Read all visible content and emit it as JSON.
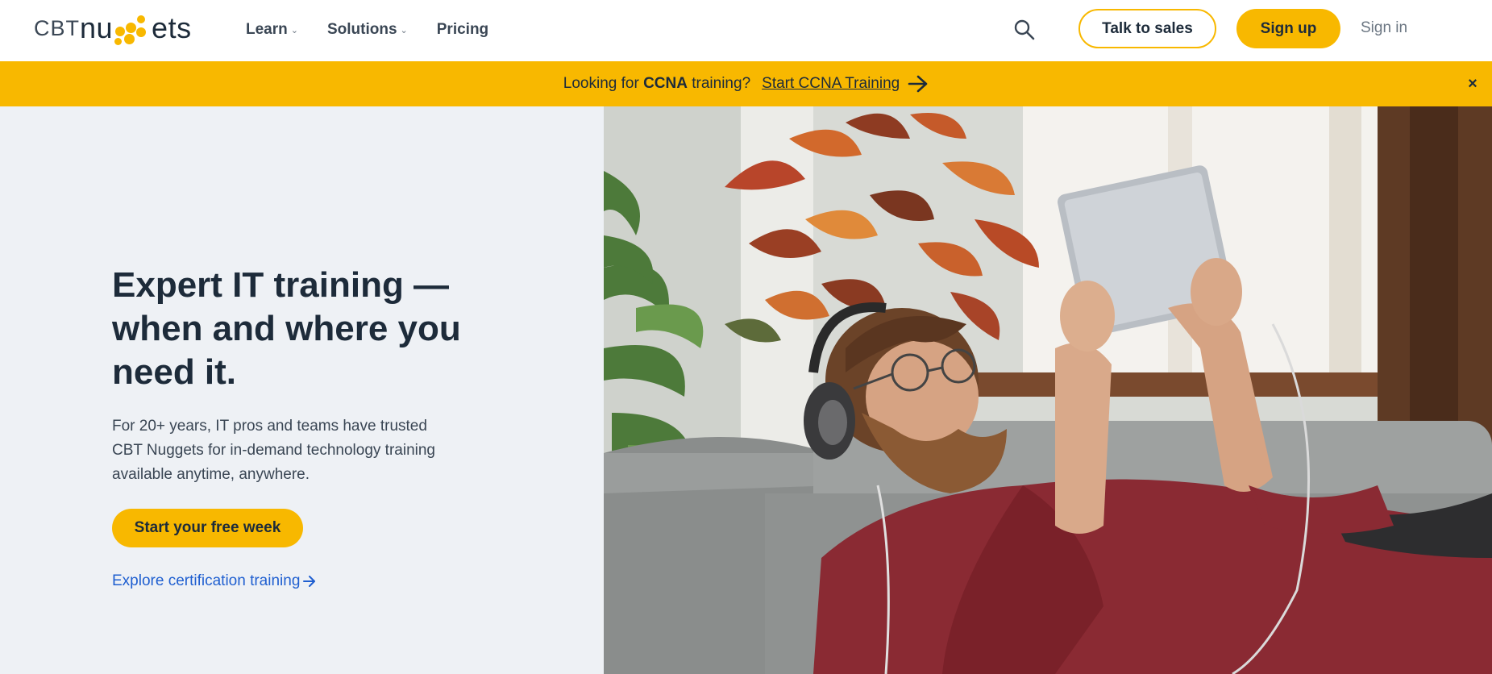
{
  "logo": {
    "part1": "CBT",
    "part2a": "nu",
    "part2b": "ets"
  },
  "nav": {
    "learn": "Learn",
    "solutions": "Solutions",
    "pricing": "Pricing"
  },
  "header": {
    "talk_to_sales": "Talk to sales",
    "sign_up": "Sign up",
    "sign_in": "Sign in"
  },
  "banner": {
    "prefix": "Looking for ",
    "bold": "CCNA",
    "suffix": " training?",
    "link": "Start CCNA Training",
    "close": "×"
  },
  "hero": {
    "title_line1": "Expert IT training —",
    "title_line2": "when and where you",
    "title_line3": "need it.",
    "description": "For 20+ years, IT pros and teams have trusted CBT Nuggets for in-demand technology training available anytime, anywhere.",
    "cta": "Start your free week",
    "explore_link": "Explore certification training"
  },
  "colors": {
    "accent": "#f8b800",
    "text": "#1d2b3a",
    "link": "#1f5fd0",
    "hero_bg": "#eef1f5"
  },
  "icons": {
    "search": "search-icon",
    "arrow": "arrow-right-icon",
    "close": "close-icon",
    "chevron": "chevron-down-icon"
  }
}
